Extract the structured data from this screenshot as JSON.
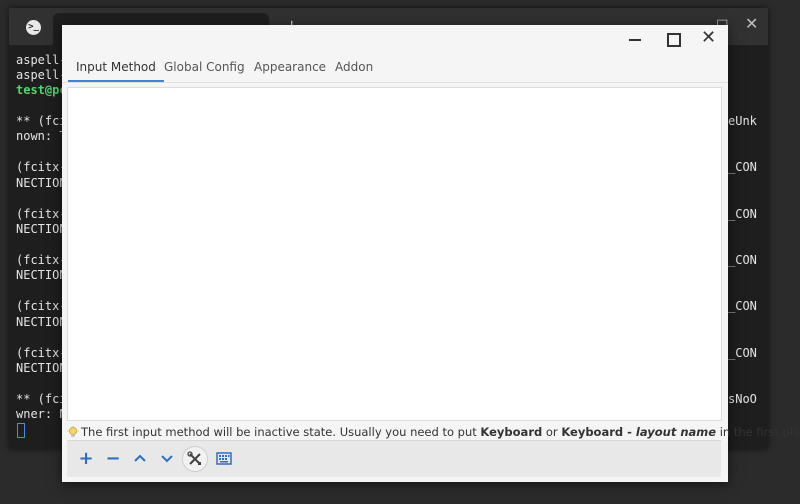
{
  "terminal": {
    "logo": ">_",
    "new_tab": "+",
    "lines": [
      "aspell-",
      "aspell-",
      "test@pc",
      "** (fci",
      "nown: T",
      "(fcitx-",
      "NECTION",
      "(fcitx-",
      "NECTION",
      "(fcitx-",
      "NECTION",
      "(fcitx-",
      "NECTION",
      "(fcitx-",
      "NECTION",
      "** (fci",
      "wner: N"
    ],
    "right_lines": [
      "eUnk",
      "_CON",
      "_CON",
      "_CON",
      "_CON",
      "_CON",
      "sNoO"
    ]
  },
  "dialog": {
    "window_controls": {
      "minimize": "",
      "maximize": "",
      "close": "✕"
    },
    "tabs": [
      {
        "label": "Input Method"
      },
      {
        "label": "Global Config"
      },
      {
        "label": "Appearance"
      },
      {
        "label": "Addon"
      }
    ],
    "active_tab": "Input Method",
    "hint": {
      "prefix": "The first input method will be inactive state. Usually you need to put ",
      "keyword1": "Keyboard",
      "middle": " or ",
      "keyword2": "Keyboard - ",
      "keyword2_italic": "layout name",
      "suffix": " in the first place."
    },
    "toolbar": {
      "add": "+",
      "remove": "−",
      "move_up": "⌃",
      "move_down": "⌄"
    },
    "colors": {
      "accent": "#3d84d6",
      "toolbar_icon": "#2f6fc2"
    }
  }
}
